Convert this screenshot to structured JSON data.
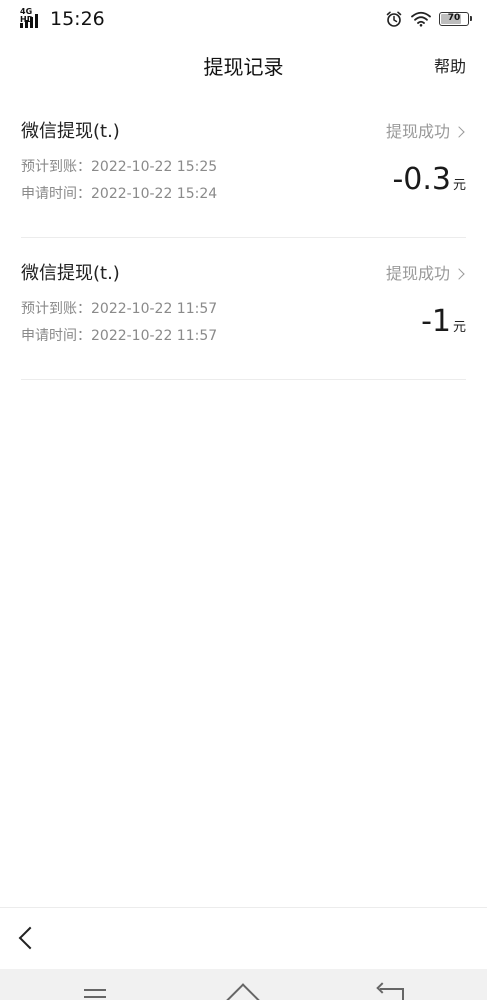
{
  "status_bar": {
    "network": "4G HD",
    "time": "15:26",
    "battery": "70",
    "battery_level": 0.7,
    "icons": [
      "alarm-icon",
      "wifi-icon",
      "battery-icon"
    ]
  },
  "header": {
    "title": "提现记录",
    "help_label": "帮助"
  },
  "records": [
    {
      "name": "微信提现(t.)",
      "status": "提现成功",
      "expected_label": "预计到账：",
      "expected_time": "2022-10-22 15:25",
      "apply_label": "申请时间：",
      "apply_time": "2022-10-22 15:24",
      "amount": "-0.3",
      "unit": "元"
    },
    {
      "name": "微信提现(t.)",
      "status": "提现成功",
      "expected_label": "预计到账：",
      "expected_time": "2022-10-22 11:57",
      "apply_label": "申请时间：",
      "apply_time": "2022-10-22 11:57",
      "amount": "-1",
      "unit": "元"
    }
  ],
  "colors": {
    "text_primary": "#222222",
    "text_secondary": "#8a8a8a",
    "status_gray": "#9a9a9a",
    "divider": "#ececec",
    "nav_bg": "#f1f1f1"
  }
}
